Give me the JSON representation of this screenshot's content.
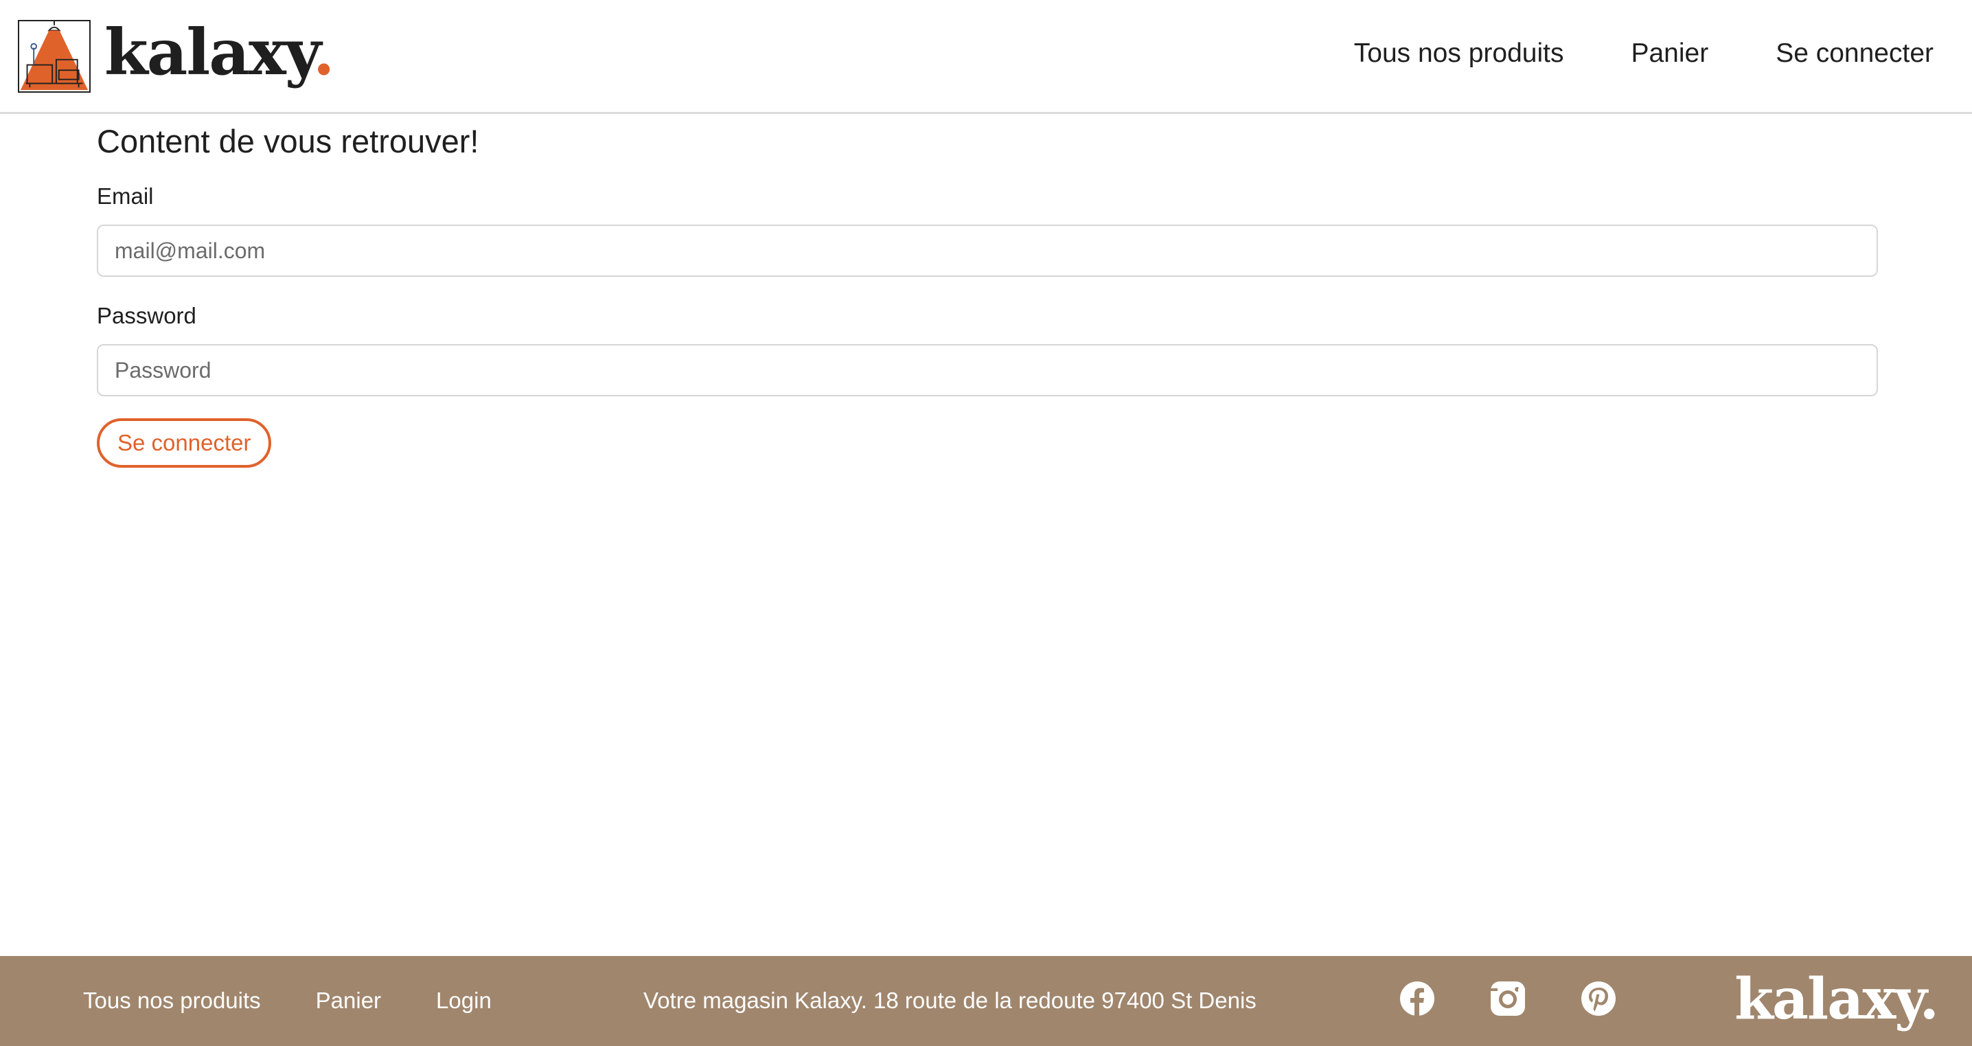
{
  "header": {
    "logo_text": "kalaxy",
    "logo_dot": ".",
    "nav": {
      "products": "Tous nos produits",
      "cart": "Panier",
      "login": "Se connecter"
    }
  },
  "login_form": {
    "title": "Content de vous retrouver!",
    "email_label": "Email",
    "email_placeholder": "mail@mail.com",
    "password_label": "Password",
    "password_placeholder": "Password",
    "submit_label": "Se connecter"
  },
  "footer": {
    "links": {
      "products": "Tous nos produits",
      "cart": "Panier",
      "login": "Login"
    },
    "address": "Votre magasin Kalaxy. 18 route de la redoute 97400 St Denis",
    "social_icons": [
      "facebook-icon",
      "instagram-icon",
      "pinterest-icon"
    ],
    "logo_text": "kalaxy."
  },
  "colors": {
    "accent": "#e0622b",
    "footer_bg": "#a0866d",
    "text": "#1f1f1f"
  }
}
